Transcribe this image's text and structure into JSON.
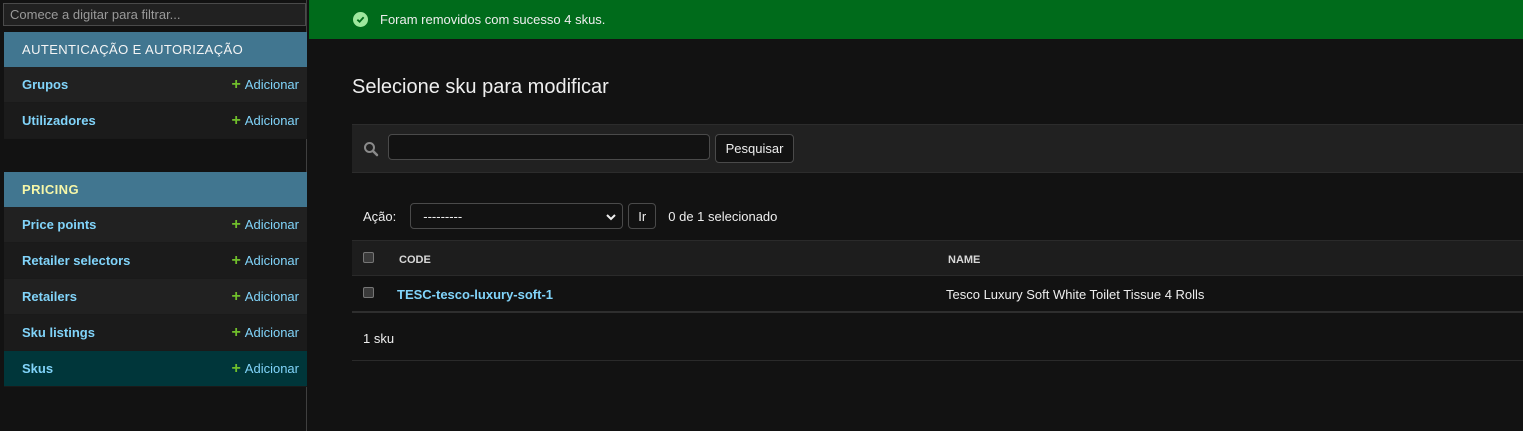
{
  "sidebar": {
    "filter_placeholder": "Comece a digitar para filtrar...",
    "modules": [
      {
        "header": "AUTENTICAÇÃO E AUTORIZAÇÃO",
        "items": [
          {
            "label": "Grupos",
            "add": "Adicionar"
          },
          {
            "label": "Utilizadores",
            "add": "Adicionar"
          }
        ]
      },
      {
        "header": "PRICING",
        "items": [
          {
            "label": "Price points",
            "add": "Adicionar"
          },
          {
            "label": "Retailer selectors",
            "add": "Adicionar"
          },
          {
            "label": "Retailers",
            "add": "Adicionar"
          },
          {
            "label": "Sku listings",
            "add": "Adicionar"
          },
          {
            "label": "Skus",
            "add": "Adicionar"
          }
        ]
      }
    ]
  },
  "message": {
    "text": "Foram removidos com sucesso 4 skus.",
    "icon": "check-circle-icon",
    "color": "#006b1b"
  },
  "main": {
    "title": "Selecione sku para modificar",
    "search": {
      "value": "",
      "button": "Pesquisar"
    },
    "actions": {
      "label": "Ação:",
      "selected": "---------",
      "go_button": "Ir",
      "selection_count": "0 de 1 selecionado"
    },
    "table": {
      "columns": [
        "CODE",
        "NAME"
      ],
      "rows": [
        {
          "code": "TESC-tesco-luxury-soft-1",
          "name": "Tesco Luxury Soft White Toilet Tissue 4 Rolls"
        }
      ]
    },
    "result_count": "1 sku"
  },
  "colors": {
    "module_header": "#417690",
    "link": "#81d4fa",
    "add_plus": "#70bf2b",
    "selected_row": "#00363a"
  }
}
